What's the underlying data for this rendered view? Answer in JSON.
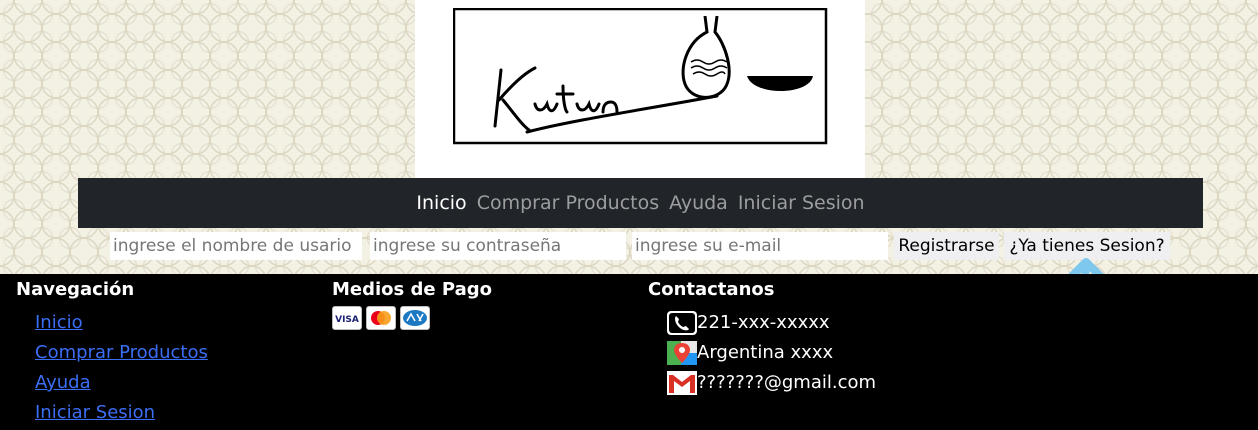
{
  "logo": {
    "brand_script": "Kutun"
  },
  "navbar": {
    "items": [
      {
        "label": "Inicio",
        "active": true
      },
      {
        "label": "Comprar Productos",
        "active": false
      },
      {
        "label": "Ayuda",
        "active": false
      },
      {
        "label": "Iniciar Sesion",
        "active": false
      }
    ]
  },
  "form": {
    "username_placeholder": "ingrese el nombre de usario",
    "password_placeholder": "ingrese su contraseña",
    "email_placeholder": "ingrese su e-mail",
    "register_label": "Registrarse",
    "have_session_label": "¿Ya tienes Sesion?"
  },
  "footer": {
    "nav": {
      "title": "Navegación",
      "links": [
        "Inicio",
        "Comprar Productos",
        "Ayuda",
        "Iniciar Sesion"
      ]
    },
    "payments": {
      "title": "Medios de Pago",
      "cards": [
        "visa-icon",
        "mastercard-icon",
        "cabal-icon"
      ]
    },
    "contact": {
      "title": "Contactanos",
      "phone": "221-xxx-xxxxx",
      "location": "Argentina xxxx",
      "email": "???????@gmail.com"
    }
  },
  "colors": {
    "navbar_bg": "#212529",
    "footer_bg": "#000000",
    "link": "#3c6ef5",
    "arrow": "#7ec8ee"
  }
}
